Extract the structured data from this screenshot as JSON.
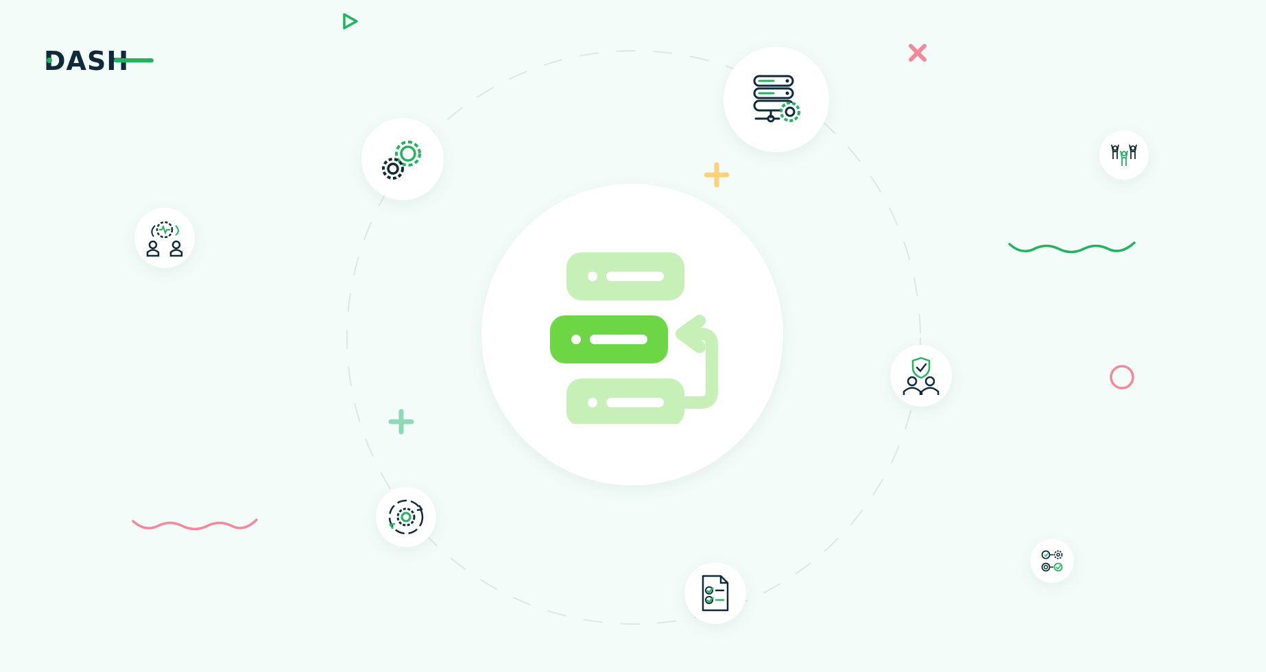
{
  "brand": {
    "logo_text": "DASH",
    "logo_icon": "dash-logo",
    "colors": {
      "navy": "#0f2a3a",
      "green": "#22b35e"
    }
  },
  "palette": {
    "background": "#f3fcf9",
    "light_green": "#c6f0b8",
    "bright_green": "#6dd645",
    "accent_green": "#22b35e",
    "pink": "#f4889a",
    "yellow": "#ffd27a",
    "mint": "#8fd9b6"
  },
  "icons": [
    "database-migration-icon",
    "gears-icon",
    "server-settings-icon",
    "team-gear-icon",
    "cycle-gear-icon",
    "checklist-document-icon",
    "security-team-icon",
    "team-celebration-icon",
    "workflow-icon"
  ]
}
